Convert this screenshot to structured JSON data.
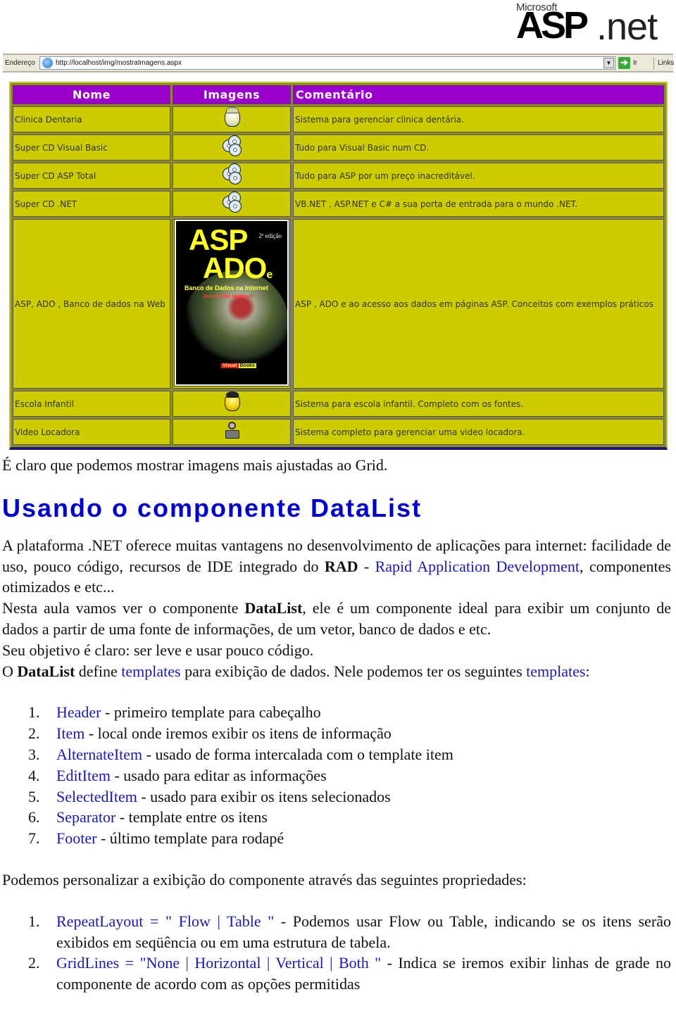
{
  "logo": {
    "company": "Microsoft",
    "product_bold": "ASP",
    "product_light": ".net"
  },
  "browser": {
    "address_label": "Endereço",
    "url": "http://localhost/img/mostraImagens.aspx",
    "go_label": "Ir",
    "links_label": "Links"
  },
  "grid": {
    "colors": {
      "header_bg": "#9a00cc",
      "cell_bg": "#cccc00",
      "header_text": "#ffffff"
    },
    "headers": [
      "Nome",
      "Imagens",
      "Comentário"
    ],
    "rows": [
      {
        "nome": "Clinica Dentaria",
        "imagem": "dental-cartoon-icon",
        "comentario": "Sistema para gerenciar clinica dentária."
      },
      {
        "nome": "Super CD Visual Basic",
        "imagem": "cd-stack-icon",
        "comentario": "Tudo para Visual Basic num CD."
      },
      {
        "nome": "Super CD ASP Total",
        "imagem": "cd-stack-icon",
        "comentario": "Tudo para ASP por um preço inacreditável."
      },
      {
        "nome": "Super CD .NET",
        "imagem": "cd-stack-icon",
        "comentario": "VB.NET , ASP.NET e C# a sua porta de entrada para o mundo .NET."
      },
      {
        "nome": "ASP, ADO , Banco de dados na Web",
        "imagem": "book-cover-image",
        "comentario": "ASP , ADO e ao acesso aos dados em páginas ASP. Conceitos com exemplos práticos"
      },
      {
        "nome": "Escola Infantil",
        "imagem": "school-kid-icon",
        "comentario": "Sistema para escola infantil. Completo com os fontes."
      },
      {
        "nome": "Video Locadora",
        "imagem": "film-projector-icon",
        "comentario": "Sistema completo para gerenciar uma video locadora."
      }
    ],
    "book_cover": {
      "title_line1": "ASP",
      "title_line2": "ADO",
      "title_conj": "e",
      "edition": "2ª edição",
      "subtitle": "Banco de Dados na Internet",
      "author": "José Carlos Macoratti",
      "publisher_1": "Visual",
      "publisher_2": "Books"
    }
  },
  "content": {
    "intro": "É claro que podemos mostrar imagens mais ajustadas ao Grid.",
    "heading": "Usando o componente DataList",
    "p1": {
      "t1": "A plataforma .NET oferece muitas vantagens no desenvolvimento de aplicações para internet: facilidade de uso, pouco código, recursos de IDE integrado do ",
      "b1": "RAD",
      "t2": " - ",
      "link": "Rapid Application Development",
      "t3": ", componentes otimizados e etc..."
    },
    "p2": {
      "t1": "Nesta aula vamos ver o componente ",
      "b1": "DataList",
      "t2": ", ele é um componente ideal para exibir um conjunto de dados a partir de uma fonte de informações, de um vetor, banco de dados e etc."
    },
    "p3": "Seu objetivo é claro: ser leve e usar pouco código.",
    "p4": {
      "t1": "O ",
      "b1": "DataList",
      "t2": " define ",
      "link1": "templates",
      "t3": " para exibição de dados. Nele podemos ter os seguintes ",
      "link2": "templates",
      "t4": ":"
    },
    "templates": [
      {
        "num": "1.",
        "name": "Header",
        "desc": " - primeiro template para cabeçalho"
      },
      {
        "num": "2.",
        "name": "Item",
        "desc": " - local onde iremos exibir os itens de informação"
      },
      {
        "num": "3.",
        "name": "AlternateItem",
        "desc": " - usado de forma intercalada com o template item"
      },
      {
        "num": "4.",
        "name": "EditItem",
        "desc": " - usado para editar as informações"
      },
      {
        "num": "5.",
        "name": "SelectedItem",
        "desc": " - usado para exibir os itens selecionados"
      },
      {
        "num": "6.",
        "name": "Separator",
        "desc": " - template entre os itens"
      },
      {
        "num": "7.",
        "name": "Footer",
        "desc": " - último template para rodapé"
      }
    ],
    "p5": "Podemos personalizar a exibição do componente através das seguintes propriedades:",
    "properties": [
      {
        "num": "1.",
        "name": "RepeatLayout = \" Flow | Table \"",
        "desc": " - Podemos usar Flow ou Table, indicando se os itens serão exibidos em seqüência ou em uma estrutura de tabela."
      },
      {
        "num": "2.",
        "name": "GridLines = \"None | Horizontal | Vertical | Both \"",
        "desc": " - Indica se iremos exibir linhas de grade no componente de acordo com as opções permitidas"
      }
    ]
  }
}
